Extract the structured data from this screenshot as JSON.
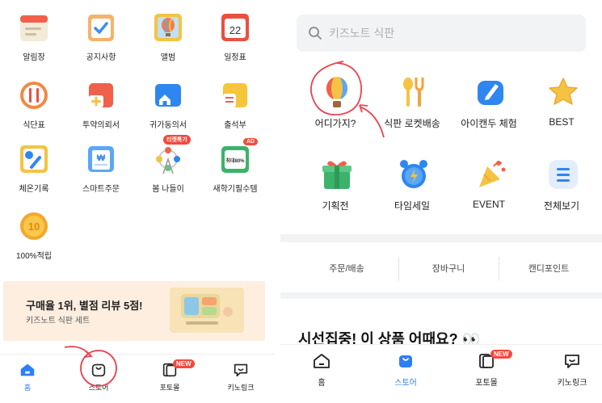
{
  "left": {
    "menu": [
      {
        "label": "알림장",
        "icon": "notebook-icon"
      },
      {
        "label": "공지사항",
        "icon": "clipboard-check-icon"
      },
      {
        "label": "앨범",
        "icon": "balloon-album-icon"
      },
      {
        "label": "일정표",
        "icon": "calendar-icon",
        "date": "22"
      },
      {
        "label": "식단표",
        "icon": "fork-knife-icon"
      },
      {
        "label": "투약의뢰서",
        "icon": "medicine-icon"
      },
      {
        "label": "귀가동의서",
        "icon": "home-ticket-icon"
      },
      {
        "label": "출석부",
        "icon": "attendance-icon"
      },
      {
        "label": "체온기록",
        "icon": "thermometer-icon"
      },
      {
        "label": "스마트주문",
        "icon": "receipt-won-icon"
      },
      {
        "label": "봄 나들이",
        "icon": "ferris-wheel-icon",
        "badge": "티켓특가"
      },
      {
        "label": "새학기필수템",
        "icon": "gift-box-icon",
        "badge": "AD",
        "box_text": "최대80%"
      },
      {
        "label": "100%적립",
        "icon": "coin-icon",
        "coin_text": "10"
      }
    ],
    "banner": {
      "title": "구매율 1위, 별점 리뷰 5점!",
      "subtitle": "키즈노트 식판 세트"
    },
    "nav": [
      {
        "label": "홈",
        "icon": "home-icon",
        "active": true
      },
      {
        "label": "스토어",
        "icon": "store-bag-icon",
        "active": false
      },
      {
        "label": "포토몰",
        "icon": "photo-book-icon",
        "active": false,
        "badge": "NEW"
      },
      {
        "label": "키노링크",
        "icon": "chat-bubble-icon",
        "active": false
      }
    ]
  },
  "right": {
    "search": {
      "placeholder": "키즈노트 식판"
    },
    "menu": [
      {
        "label": "어디가지?",
        "icon": "hot-air-balloon-icon"
      },
      {
        "label": "식판 로켓배송",
        "icon": "spoon-fork-icon"
      },
      {
        "label": "아이캔두 체험",
        "icon": "pen-note-icon"
      },
      {
        "label": "BEST",
        "icon": "star-icon"
      },
      {
        "label": "기획전",
        "icon": "gift-icon"
      },
      {
        "label": "타임세일",
        "icon": "alarm-clock-icon"
      },
      {
        "label": "EVENT",
        "icon": "party-popper-icon"
      },
      {
        "label": "전체보기",
        "icon": "list-icon"
      }
    ],
    "tabs": [
      "주문/배송",
      "장바구니",
      "캔디포인트"
    ],
    "section_title": "시선집중! 이 상품 어때요? 👀",
    "nav": [
      {
        "label": "홈",
        "icon": "home-icon",
        "active": false
      },
      {
        "label": "스토어",
        "icon": "store-bag-icon",
        "active": true
      },
      {
        "label": "포토몰",
        "icon": "photo-book-icon",
        "active": false,
        "badge": "NEW"
      },
      {
        "label": "키노링크",
        "icon": "chat-bubble-icon",
        "active": false
      }
    ]
  },
  "colors": {
    "accent": "#2d7ff9",
    "annotation": "#e8434f",
    "badge": "#f5483b"
  }
}
